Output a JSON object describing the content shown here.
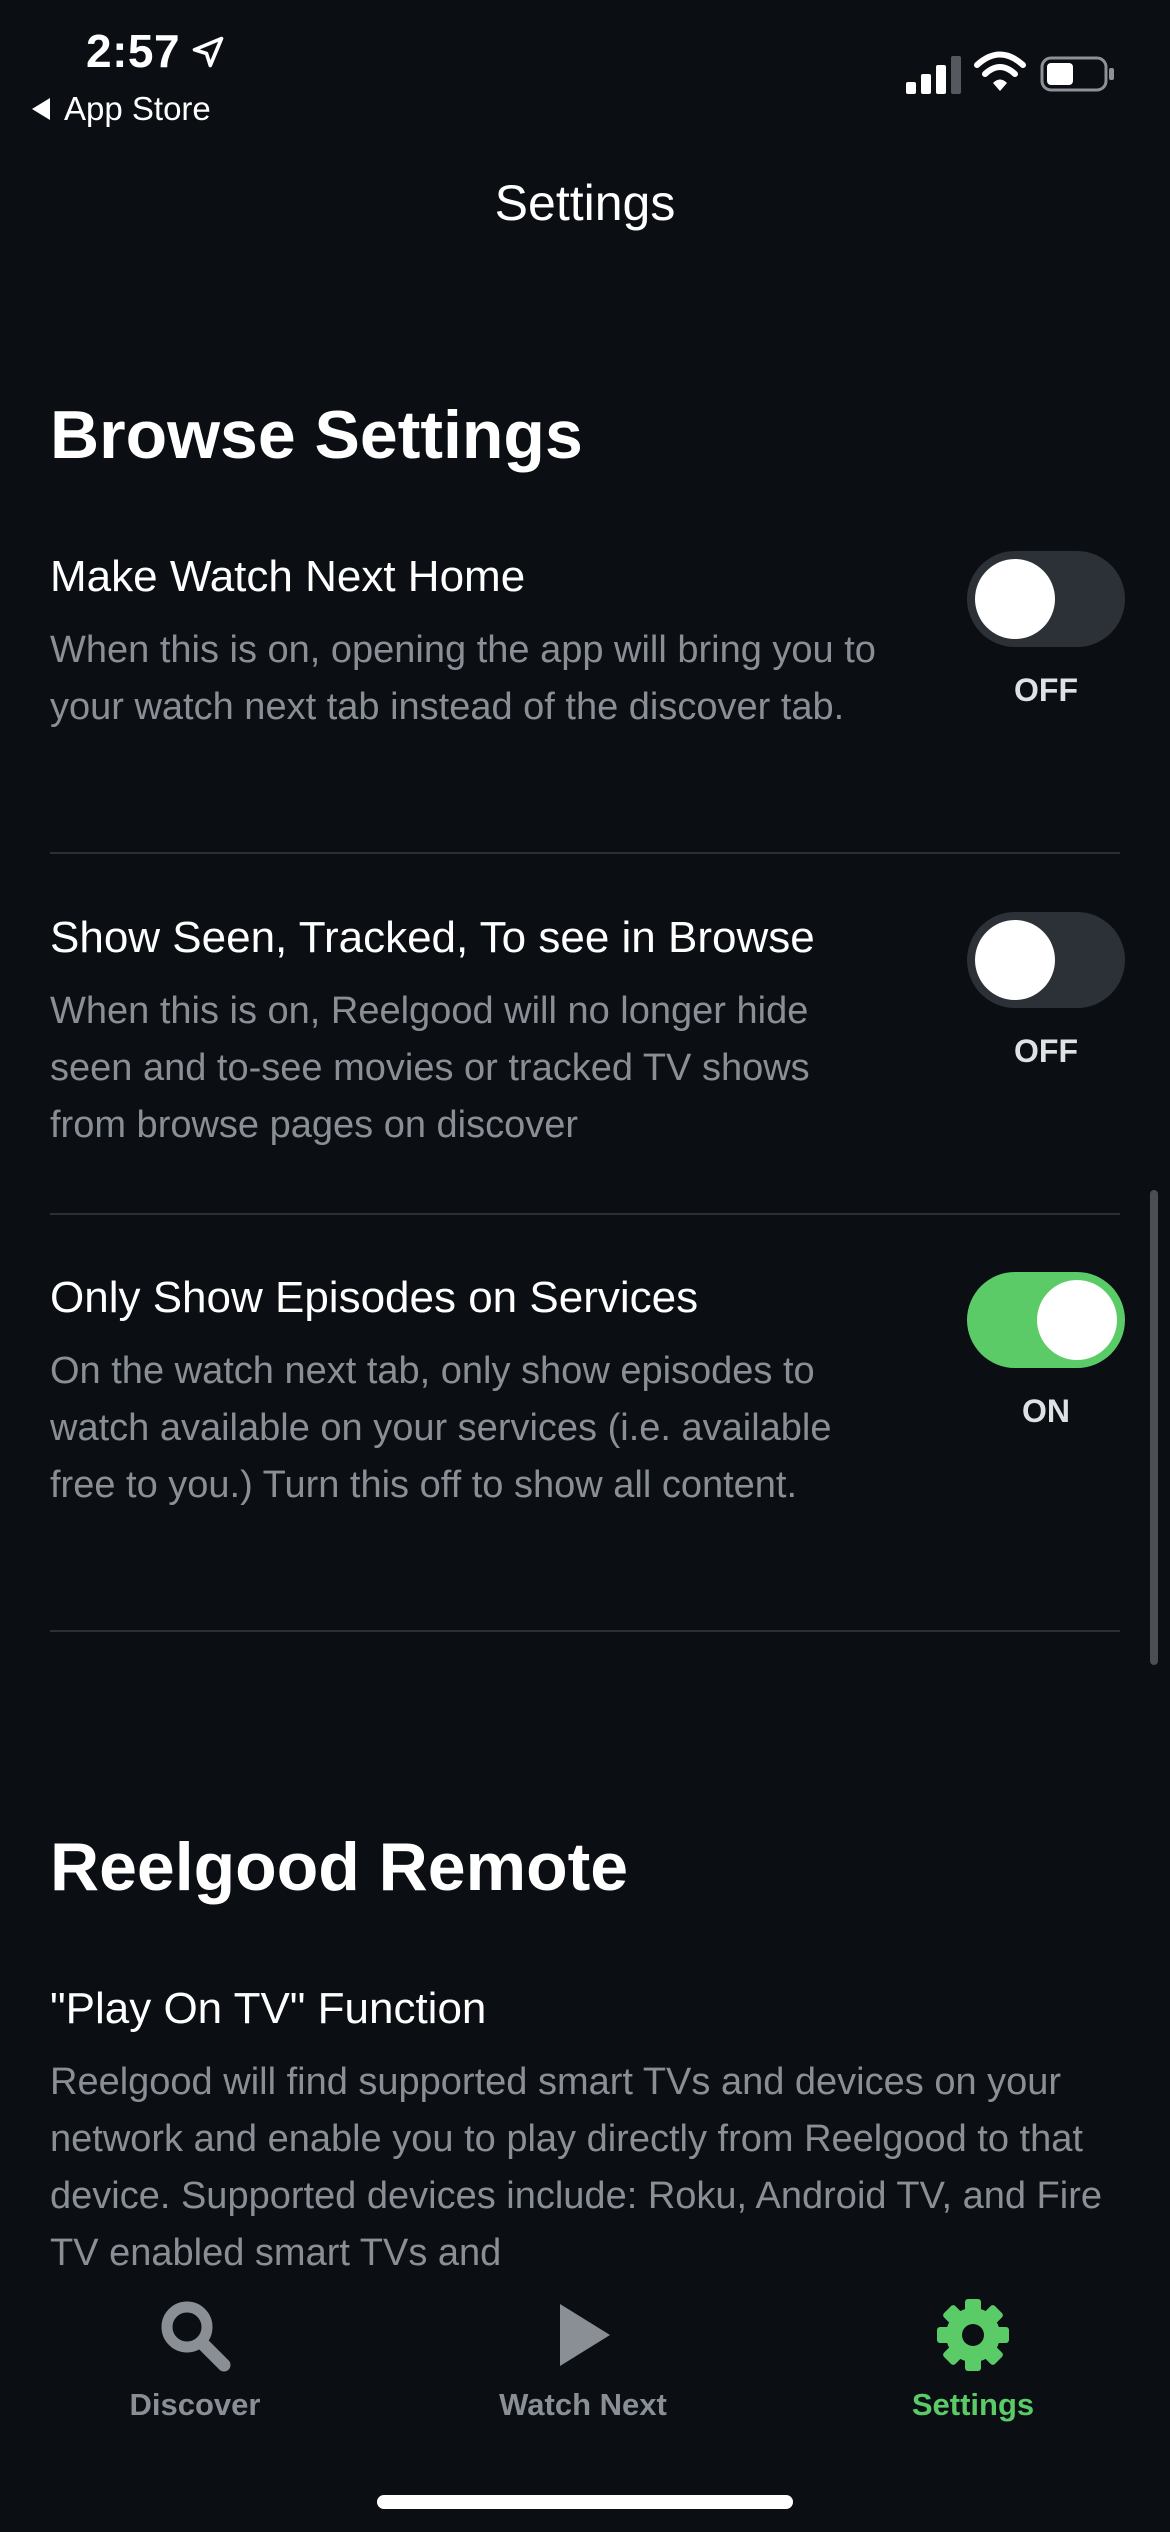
{
  "status_bar": {
    "time": "2:57",
    "back_app": "App Store"
  },
  "nav": {
    "title": "Settings"
  },
  "browse_section": {
    "title": "Browse Settings",
    "settings": [
      {
        "title": "Make Watch Next Home",
        "description": "When this is on, opening the app will bring you to your watch next tab instead of the discover tab.",
        "state": "OFF",
        "enabled": false
      },
      {
        "title": "Show Seen, Tracked, To see in Browse",
        "description": "When this is on, Reelgood will no longer hide seen and to-see movies or tracked TV shows from browse pages on discover",
        "state": "OFF",
        "enabled": false
      },
      {
        "title": "Only Show Episodes on Services",
        "description": "On the watch next tab, only show episodes to watch available on your services (i.e. available free to you.) Turn this off to show all content.",
        "state": "ON",
        "enabled": true
      }
    ]
  },
  "remote_section": {
    "title": "Reelgood Remote",
    "setting_title": "\"Play On TV\" Function",
    "setting_description": "Reelgood will find supported smart TVs and devices on your network and enable you to play directly from Reelgood to that device. Supported devices include: Roku, Android TV, and Fire TV enabled smart TVs and"
  },
  "tab_bar": {
    "tabs": [
      {
        "label": "Discover",
        "icon": "search-icon",
        "active": false
      },
      {
        "label": "Watch Next",
        "icon": "play-icon",
        "active": false
      },
      {
        "label": "Settings",
        "icon": "gear-icon",
        "active": true
      }
    ]
  },
  "colors": {
    "background": "#0b0f14",
    "accent": "#5bcb67",
    "secondary_text": "#8a8f96",
    "toggle_off": "#2c3138"
  }
}
